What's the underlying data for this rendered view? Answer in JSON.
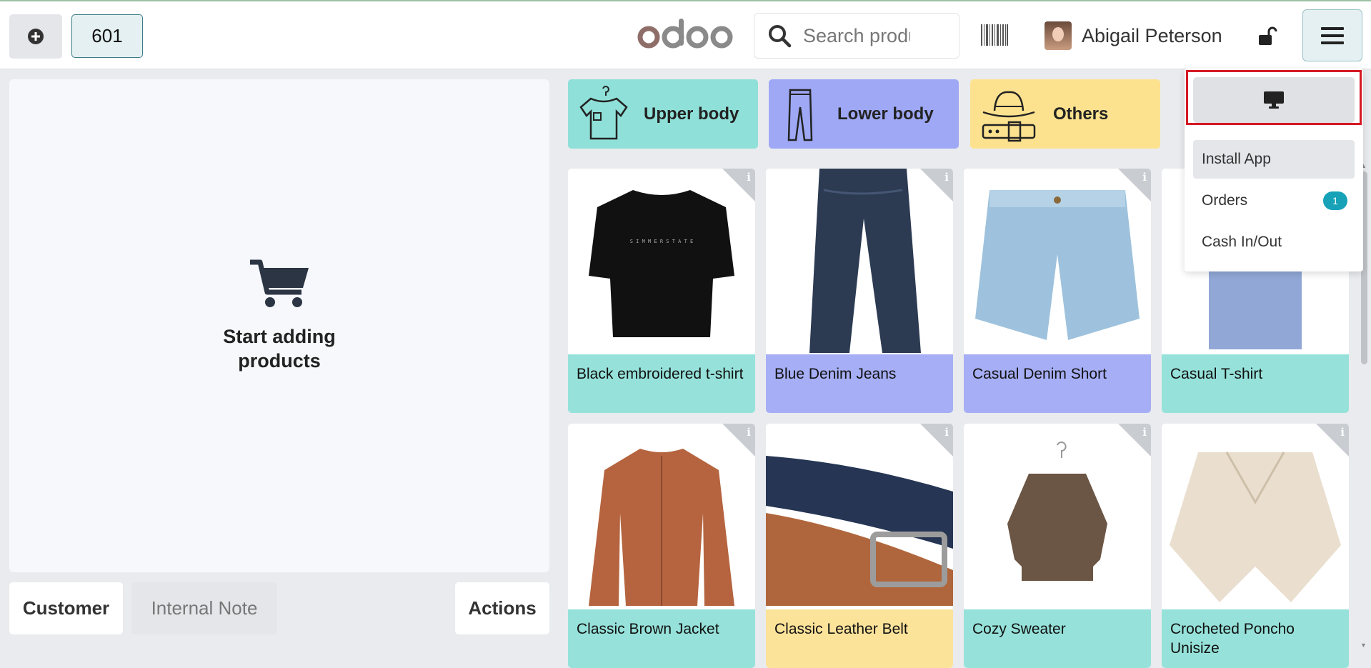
{
  "header": {
    "order_number": "601",
    "search_placeholder": "Search products...",
    "user_name": "Abigail Peterson"
  },
  "order_panel": {
    "empty_line1": "Start adding",
    "empty_line2": "products",
    "buttons": {
      "customer": "Customer",
      "internal_note": "Internal Note",
      "actions": "Actions"
    }
  },
  "categories": [
    {
      "label": "Upper body",
      "color": "#8fe0d8",
      "icon": "tshirt-icon"
    },
    {
      "label": "Lower body",
      "color": "#9ea8f5",
      "icon": "pants-icon"
    },
    {
      "label": "Others",
      "color": "#fce28f",
      "icon": "hat-belt-icon"
    }
  ],
  "products": [
    {
      "name": "Black embroidered t-shirt",
      "color": "teal"
    },
    {
      "name": "Blue Denim Jeans",
      "color": "violet"
    },
    {
      "name": "Casual Denim Short",
      "color": "violet"
    },
    {
      "name": "Casual T-shirt",
      "color": "teal"
    },
    {
      "name": "Classic Brown Jacket",
      "color": "teal"
    },
    {
      "name": "Classic Leather Belt",
      "color": "yellow"
    },
    {
      "name": "Cozy Sweater",
      "color": "teal"
    },
    {
      "name": "Crocheted Poncho Unisize",
      "color": "teal"
    }
  ],
  "menu": {
    "items": [
      {
        "label": "Install App"
      },
      {
        "label": "Orders",
        "badge": "1"
      },
      {
        "label": "Cash In/Out"
      }
    ]
  }
}
